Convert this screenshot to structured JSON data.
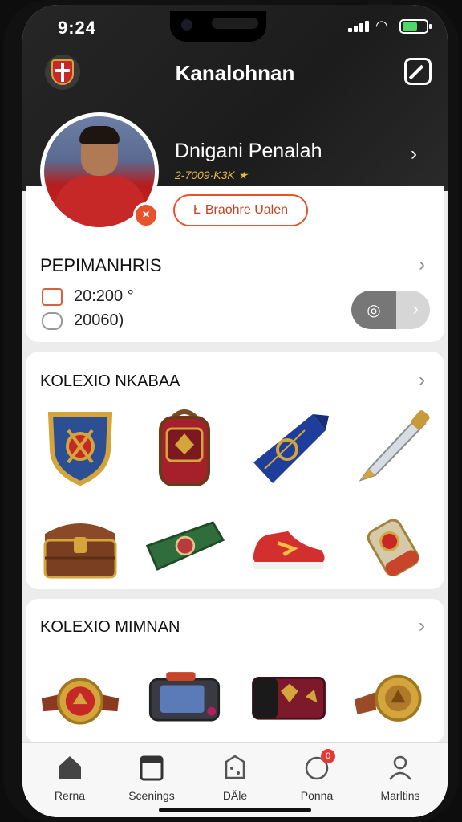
{
  "status_bar": {
    "time": "9:24"
  },
  "header": {
    "title": "Kanalohnan",
    "edit_icon": "edit-icon",
    "crest_icon": "club-crest-icon"
  },
  "profile": {
    "name": "Dnigani Penalah",
    "subtitle": "2-7009·K3K ★",
    "badge_glyph": "×",
    "tag_button_label": "Braohre Ualen",
    "tag_icon_glyph": "Ł"
  },
  "stats_card": {
    "title": "PEPIMANHRIS",
    "stats": [
      {
        "icon": "badge-icon",
        "value": "20:200 °"
      },
      {
        "icon": "glove-icon",
        "value": "20060)"
      }
    ],
    "toggle_icon": "camera-icon"
  },
  "collection_1": {
    "title": "KOLEXIO NKABAA",
    "items": [
      "shield-item",
      "backpack-item",
      "scarf-item",
      "sword-item",
      "chest-item",
      "wristband-item",
      "sneaker-item",
      "canister-item"
    ]
  },
  "collection_2": {
    "title": "KOLEXIO MIMNAN",
    "items": [
      "medal-watch-item",
      "camera-item",
      "wallet-item",
      "bracelet-item"
    ]
  },
  "bottom_nav": {
    "items": [
      {
        "label": "Rerna",
        "icon": "home-icon"
      },
      {
        "label": "Scenings",
        "icon": "calendar-icon"
      },
      {
        "label": "DÄle",
        "icon": "dice-icon"
      },
      {
        "label": "Ponna",
        "icon": "heart-icon",
        "badge": "0"
      },
      {
        "label": "Marltins",
        "icon": "user-icon"
      }
    ]
  },
  "colors": {
    "accent": "#e8532c",
    "header_bg": "#1f1f1f",
    "gold": "#d4a53a"
  }
}
